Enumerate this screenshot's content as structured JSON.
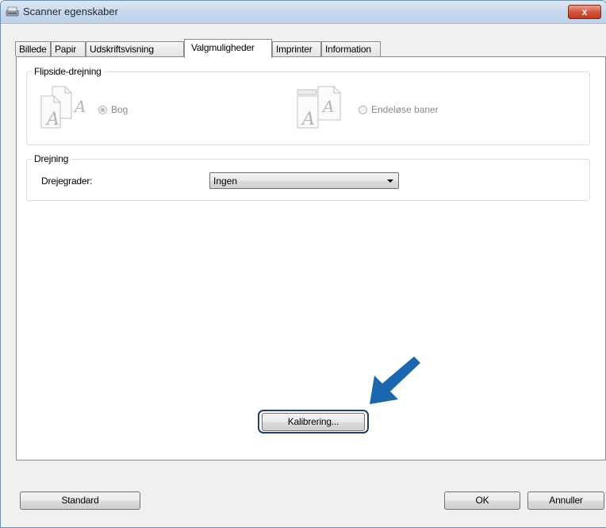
{
  "window": {
    "title": "Scanner egenskaber",
    "close_symbol": "x"
  },
  "tabs": [
    {
      "label": "Billede",
      "active": false
    },
    {
      "label": "Papir",
      "active": false
    },
    {
      "label": "Udskriftsvisning",
      "active": false
    },
    {
      "label": "Valgmuligheder",
      "active": true
    },
    {
      "label": "Imprinter",
      "active": false
    },
    {
      "label": "Information",
      "active": false
    }
  ],
  "flipside": {
    "group_label": "Flipside-drejning",
    "option_book": {
      "label": "Bog",
      "selected": true,
      "enabled": false
    },
    "option_fanfold": {
      "label": "Endeløse baner",
      "selected": false,
      "enabled": false
    },
    "icon_glyph": "A"
  },
  "rotation": {
    "group_label": "Drejning",
    "field_label": "Drejegrader:",
    "selected_value": "Ingen"
  },
  "calibrate_button": "Kalibrering...",
  "footer": {
    "standard_button": "Standard",
    "ok_button": "OK",
    "cancel_button": "Annuller"
  },
  "colors": {
    "arrow_blue": "#1a67b0",
    "title_bar": "#c6d7ec",
    "close_red": "#d5553e"
  }
}
